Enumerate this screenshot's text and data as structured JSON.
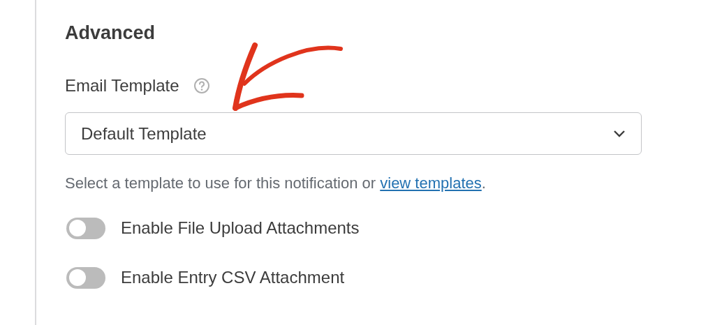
{
  "section": {
    "title": "Advanced"
  },
  "email_template": {
    "label": "Email Template",
    "value": "Default Template"
  },
  "help": {
    "text": "Select a template to use for this notification or ",
    "link": "view templates",
    "after": "."
  },
  "toggles": [
    {
      "label": "Enable File Upload Attachments",
      "on": false
    },
    {
      "label": "Enable Entry CSV Attachment",
      "on": false
    }
  ]
}
